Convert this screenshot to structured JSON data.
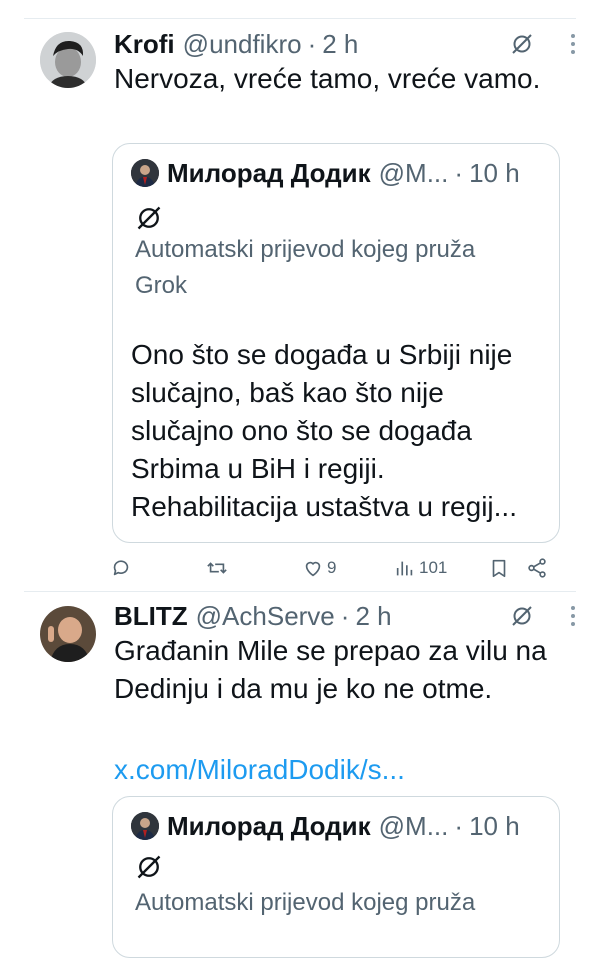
{
  "tweets": [
    {
      "author": "Krofi",
      "handle": "@undfikro",
      "separator": "·",
      "time": "2 h",
      "text": "Nervoza, vreće tamo, vreće vamo.",
      "quote": {
        "author": "Милорад Додик",
        "handle": "@M...",
        "separator": "·",
        "time": "10 h",
        "translation_note": "Automatski prijevod kojeg pruža Grok",
        "text": "Ono što se događa u Srbiji nije slučajno, baš kao što nije slučajno ono što se događa Srbima u BiH i regiji. Rehabilitacija ustaštva u regij..."
      },
      "actions": {
        "likes": "9",
        "views": "101"
      }
    },
    {
      "author": "BLITZ",
      "handle": "@AchServe",
      "separator": "·",
      "time": "2 h",
      "text": "Građanin Mile se prepao za vilu na Dedinju i da mu je ko ne otme.",
      "link": "x.com/MiloradDodik/s...",
      "quote": {
        "author": "Милорад Додик",
        "handle": "@M...",
        "separator": "·",
        "time": "10 h",
        "translation_note": "Automatski prijevod kojeg pruža"
      }
    }
  ],
  "colors": {
    "text": "#0f1419",
    "secondary": "#536471",
    "link": "#1d9bf0",
    "border": "#cfd9de"
  },
  "icons": [
    "grok-icon",
    "more-icon",
    "reply-icon",
    "retweet-icon",
    "like-icon",
    "views-icon",
    "bookmark-icon",
    "share-icon"
  ]
}
